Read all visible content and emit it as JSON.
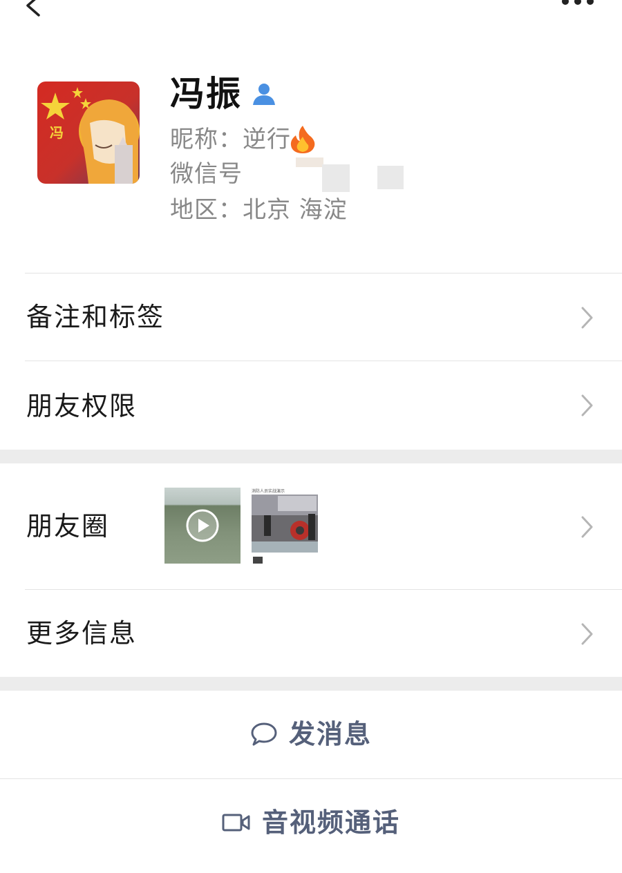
{
  "profile": {
    "name": "冯振",
    "nickname": "昵称：逆行",
    "wechat_id_label": "微信号",
    "region": "地区：北京 海淀",
    "avatar_char": "冯"
  },
  "rows": {
    "remarks": "备注和标签",
    "permissions": "朋友权限",
    "moments": "朋友圈",
    "more": "更多信息"
  },
  "moments_thumbs": {
    "second_caption": "消防人员实战演示"
  },
  "actions": {
    "message": "发消息",
    "call": "音视频通话"
  },
  "colors": {
    "accent": "#55607a",
    "contact_icon": "#4a90e2",
    "chevron": "#b5b5b5",
    "section_gap": "#ececec"
  }
}
